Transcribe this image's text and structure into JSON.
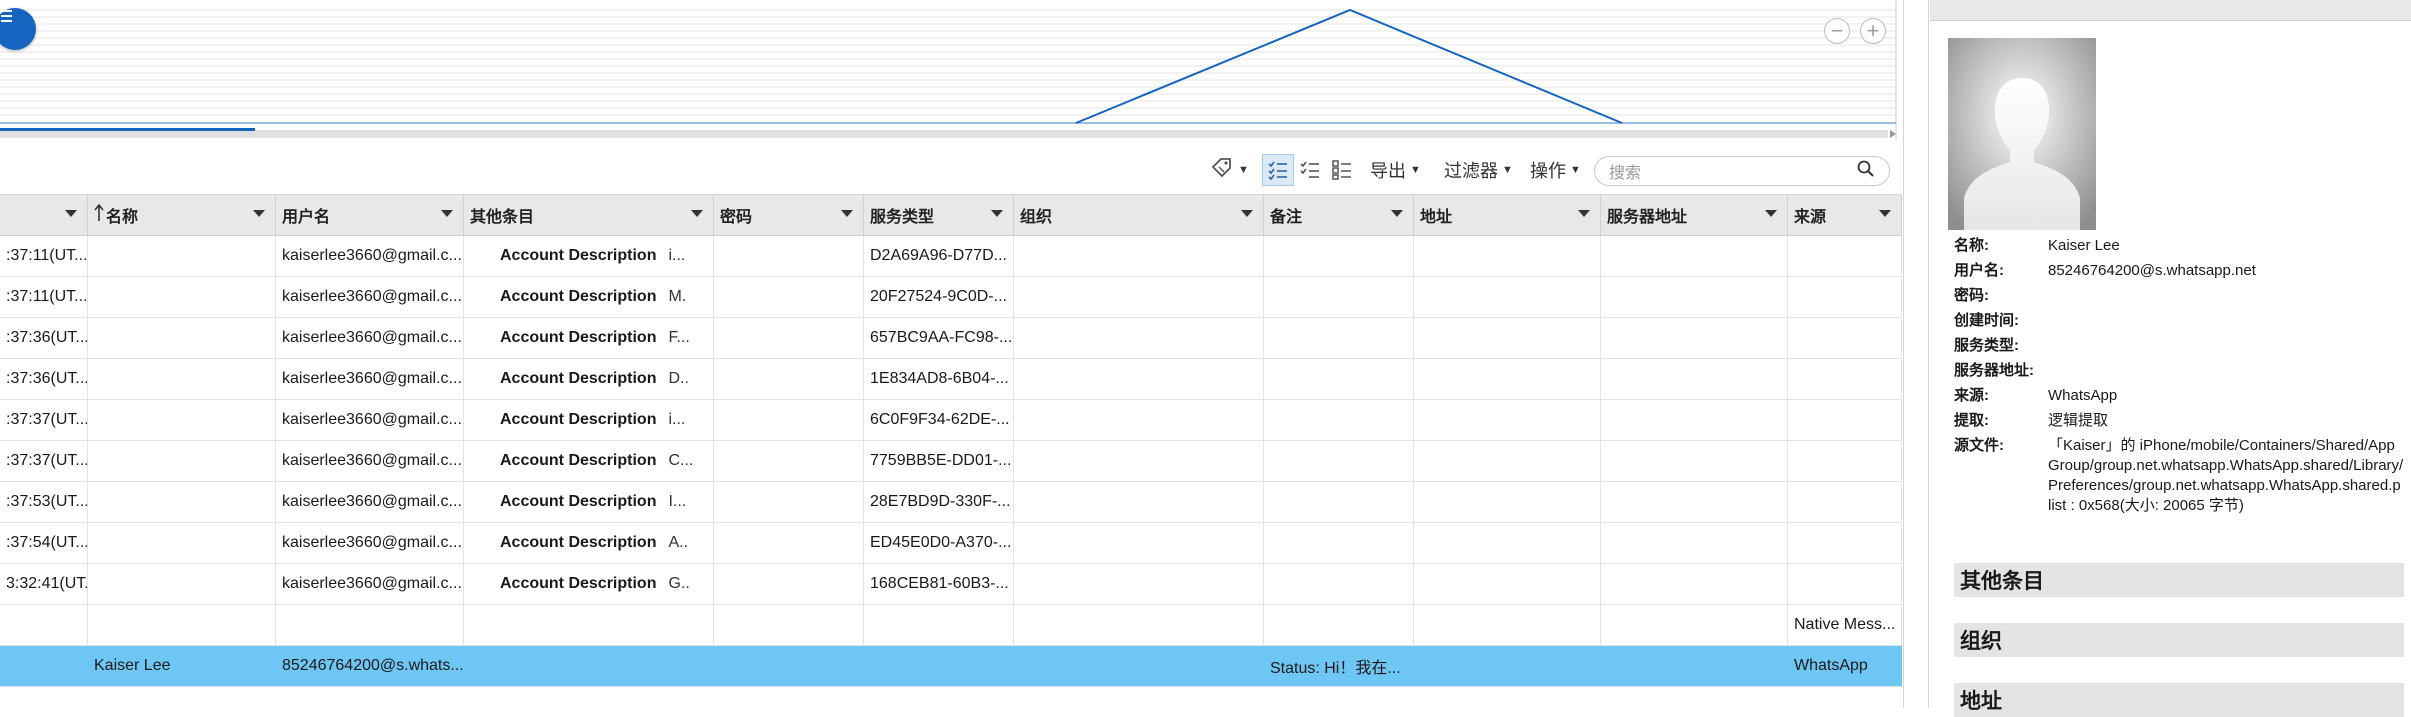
{
  "toolbar": {
    "export_label": "导出",
    "filter_label": "过滤器",
    "actions_label": "操作",
    "search_placeholder": "搜索"
  },
  "columns": [
    {
      "label": ""
    },
    {
      "label": "名称",
      "sort": "asc"
    },
    {
      "label": "用户名"
    },
    {
      "label": "其他条目"
    },
    {
      "label": "密码"
    },
    {
      "label": "服务类型"
    },
    {
      "label": "组织"
    },
    {
      "label": "备注"
    },
    {
      "label": "地址"
    },
    {
      "label": "服务器地址"
    },
    {
      "label": "来源"
    }
  ],
  "rows": [
    {
      "time": ":37:11(UT...",
      "name": "",
      "username": "kaiserlee3660@gmail.c...",
      "other_key": "Account Description",
      "other_val": "i...",
      "password": "",
      "service_type": "D2A69A96-D77D...",
      "org": "",
      "notes": "",
      "address": "",
      "server": "",
      "source": ""
    },
    {
      "time": ":37:11(UT...",
      "name": "",
      "username": "kaiserlee3660@gmail.c...",
      "other_key": "Account Description",
      "other_val": "M.",
      "password": "",
      "service_type": "20F27524-9C0D-...",
      "org": "",
      "notes": "",
      "address": "",
      "server": "",
      "source": ""
    },
    {
      "time": ":37:36(UT...",
      "name": "",
      "username": "kaiserlee3660@gmail.c...",
      "other_key": "Account Description",
      "other_val": "F...",
      "password": "",
      "service_type": "657BC9AA-FC98-...",
      "org": "",
      "notes": "",
      "address": "",
      "server": "",
      "source": ""
    },
    {
      "time": ":37:36(UT...",
      "name": "",
      "username": "kaiserlee3660@gmail.c...",
      "other_key": "Account Description",
      "other_val": "D..",
      "password": "",
      "service_type": "1E834AD8-6B04-...",
      "org": "",
      "notes": "",
      "address": "",
      "server": "",
      "source": ""
    },
    {
      "time": ":37:37(UT...",
      "name": "",
      "username": "kaiserlee3660@gmail.c...",
      "other_key": "Account Description",
      "other_val": "i...",
      "password": "",
      "service_type": "6C0F9F34-62DE-...",
      "org": "",
      "notes": "",
      "address": "",
      "server": "",
      "source": ""
    },
    {
      "time": ":37:37(UT...",
      "name": "",
      "username": "kaiserlee3660@gmail.c...",
      "other_key": "Account Description",
      "other_val": "C...",
      "password": "",
      "service_type": "7759BB5E-DD01-...",
      "org": "",
      "notes": "",
      "address": "",
      "server": "",
      "source": ""
    },
    {
      "time": ":37:53(UT...",
      "name": "",
      "username": "kaiserlee3660@gmail.c...",
      "other_key": "Account Description",
      "other_val": "I...",
      "password": "",
      "service_type": "28E7BD9D-330F-...",
      "org": "",
      "notes": "",
      "address": "",
      "server": "",
      "source": ""
    },
    {
      "time": ":37:54(UT...",
      "name": "",
      "username": "kaiserlee3660@gmail.c...",
      "other_key": "Account Description",
      "other_val": "A..",
      "password": "",
      "service_type": "ED45E0D0-A370-...",
      "org": "",
      "notes": "",
      "address": "",
      "server": "",
      "source": ""
    },
    {
      "time": "3:32:41(UT...",
      "name": "",
      "username": "kaiserlee3660@gmail.c...",
      "other_key": "Account Description",
      "other_val": "G..",
      "password": "",
      "service_type": "168CEB81-60B3-...",
      "org": "",
      "notes": "",
      "address": "",
      "server": "",
      "source": ""
    },
    {
      "time": "",
      "name": "",
      "username": "",
      "other_key": "",
      "other_val": "",
      "password": "",
      "service_type": "",
      "org": "",
      "notes": "",
      "address": "",
      "server": "",
      "source": "Native Mess..."
    },
    {
      "time": "",
      "name": "Kaiser Lee",
      "username": "85246764200@s.whats...",
      "other_key": "",
      "other_val": "",
      "password": "",
      "service_type": "",
      "org": "",
      "notes": "Status: Hi！我在...",
      "address": "",
      "server": "",
      "source": "WhatsApp",
      "selected": true
    }
  ],
  "details": {
    "props": [
      {
        "label": "名称:",
        "value": "Kaiser Lee"
      },
      {
        "label": "用户名:",
        "value": "85246764200@s.whatsapp.net"
      },
      {
        "label": "密码:",
        "value": ""
      },
      {
        "label": "创建时间:",
        "value": ""
      },
      {
        "label": "服务类型:",
        "value": ""
      },
      {
        "label": "服务器地址:",
        "value": ""
      },
      {
        "label": "来源:",
        "value": "WhatsApp"
      },
      {
        "label": "提取:",
        "value": "逻辑提取"
      },
      {
        "label": "源文件:",
        "value": "「Kaiser」的 iPhone/mobile/Containers/Shared/AppGroup/group.net.whatsapp.WhatsApp.shared/Library/Preferences/group.net.whatsapp.WhatsApp.shared.plist : 0x568(大小: 20065 字节)"
      }
    ],
    "sections": [
      "其他条目",
      "组织",
      "地址"
    ]
  },
  "colors": {
    "accent": "#1565c0",
    "selection": "#6ec6f5",
    "header_bg": "#e8e8e8"
  }
}
